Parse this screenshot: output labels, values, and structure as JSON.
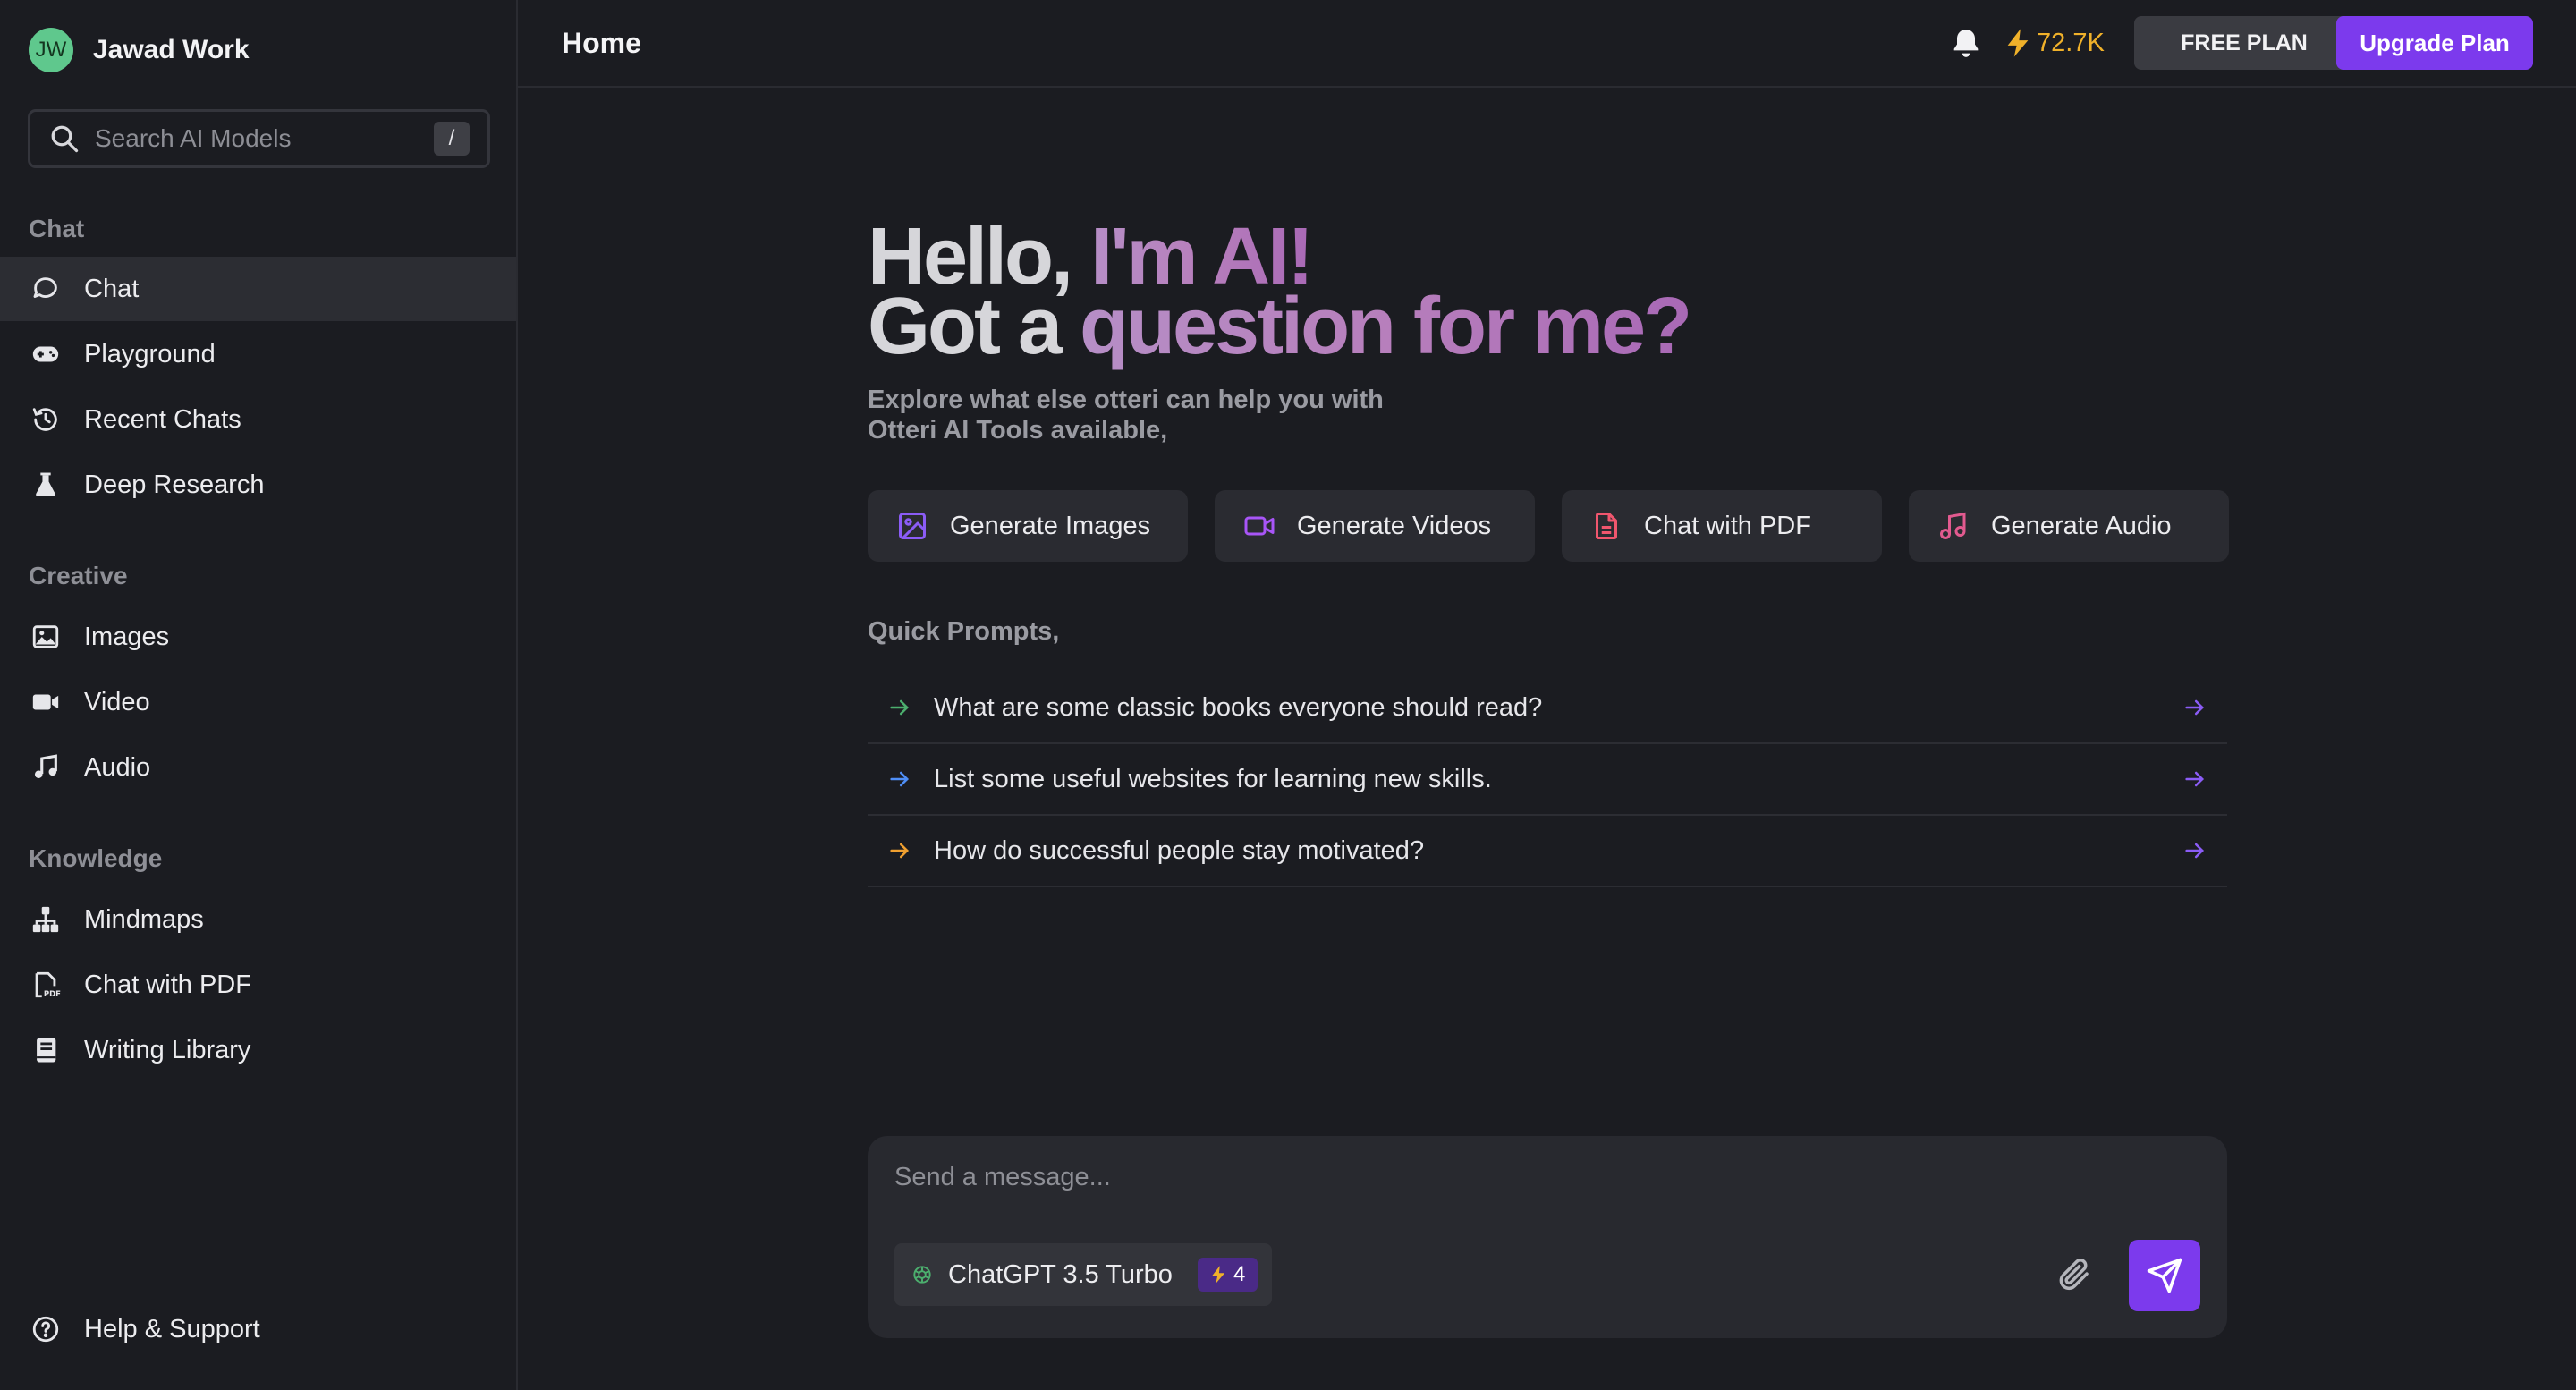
{
  "workspace": {
    "initials": "JW",
    "name": "Jawad Work"
  },
  "search": {
    "placeholder": "Search AI Models",
    "shortcut": "/"
  },
  "sidebar": {
    "sections": [
      {
        "title": "Chat",
        "items": [
          {
            "label": "Chat",
            "icon": "chat-bubble-icon",
            "active": true
          },
          {
            "label": "Playground",
            "icon": "gamepad-icon"
          },
          {
            "label": "Recent Chats",
            "icon": "history-icon"
          },
          {
            "label": "Deep Research",
            "icon": "flask-icon"
          }
        ]
      },
      {
        "title": "Creative",
        "items": [
          {
            "label": "Images",
            "icon": "image-icon"
          },
          {
            "label": "Video",
            "icon": "video-camera-icon"
          },
          {
            "label": "Audio",
            "icon": "music-note-icon"
          }
        ]
      },
      {
        "title": "Knowledge",
        "items": [
          {
            "label": "Mindmaps",
            "icon": "sitemap-icon"
          },
          {
            "label": "Chat with PDF",
            "icon": "pdf-file-icon"
          },
          {
            "label": "Writing Library",
            "icon": "book-icon"
          }
        ]
      }
    ],
    "footer": {
      "label": "Help & Support",
      "icon": "help-circle-icon"
    }
  },
  "header": {
    "title": "Home",
    "credits": "72.7K",
    "plan_label": "FREE PLAN",
    "upgrade_label": "Upgrade Plan"
  },
  "hero": {
    "line1_plain": "Hello,",
    "line1_accent": "I'm AI!",
    "line2_plain": "Got a",
    "line2_accent": "question for me?",
    "sub1": "Explore what else otteri can help you with",
    "sub2": "Otteri AI Tools available,"
  },
  "tools": [
    {
      "label": "Generate Images",
      "icon": "image-icon",
      "color": "#8b5cf6"
    },
    {
      "label": "Generate Videos",
      "icon": "video-camera-icon",
      "color": "#a855f7"
    },
    {
      "label": "Chat with PDF",
      "icon": "document-icon",
      "color": "#f0566e"
    },
    {
      "label": "Generate Audio",
      "icon": "music-note-icon",
      "color": "#e25a8f"
    }
  ],
  "quick_prompts": {
    "title": "Quick Prompts,",
    "items": [
      {
        "text": "What are some classic books everyone should read?",
        "color": "#4caf6e"
      },
      {
        "text": "List some useful websites for learning new skills.",
        "color": "#4f8ef7"
      },
      {
        "text": "How do successful people stay motivated?",
        "color": "#f0a030"
      }
    ]
  },
  "composer": {
    "placeholder": "Send a message...",
    "model": "ChatGPT 3.5 Turbo",
    "cost": "4"
  },
  "colors": {
    "accent": "#7c3aed",
    "credits": "#f0b12a",
    "avatar": "#5fc88d"
  }
}
